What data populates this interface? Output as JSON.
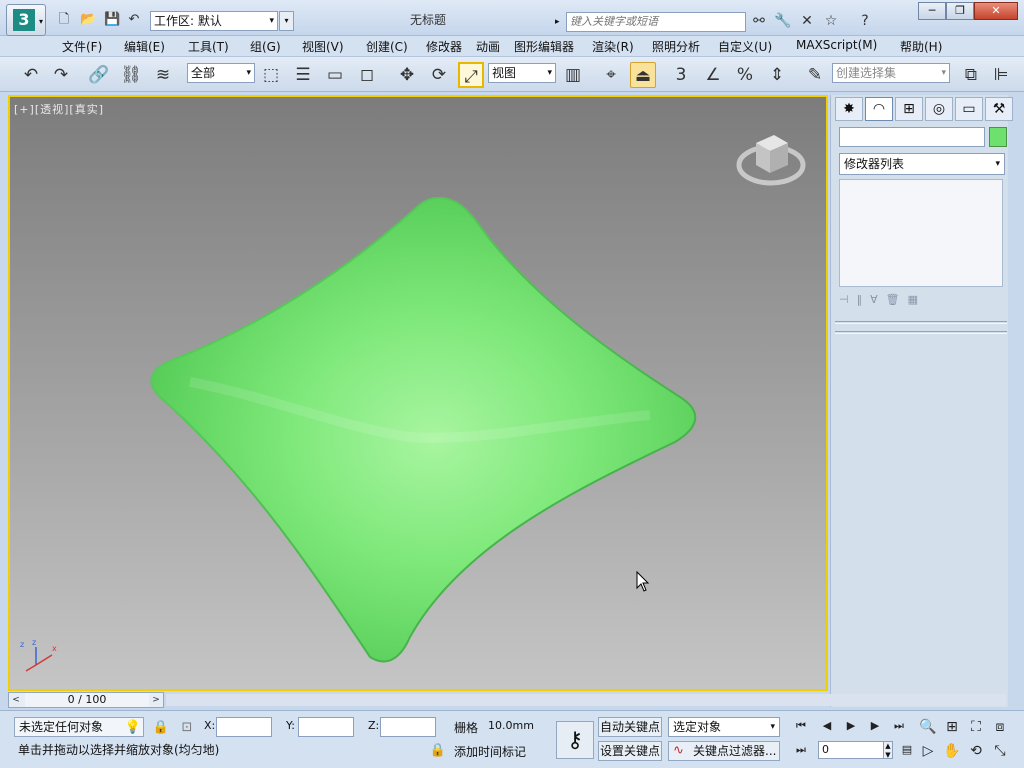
{
  "title_bar": {
    "app_logo": "3",
    "workspace_label": "工作区: 默认",
    "document_title": "无标题",
    "search_placeholder": "键入关键字或短语",
    "quick_access_icons": [
      "new-file-icon",
      "open-folder-icon",
      "save-icon",
      "undo-arrow-icon",
      "redo-arrow-icon"
    ],
    "info_icons": [
      "binoculars-icon",
      "wrench-icon",
      "exchange-icon",
      "star-icon",
      "help-icon"
    ]
  },
  "menu": {
    "items": [
      "文件(F)",
      "编辑(E)",
      "工具(T)",
      "组(G)",
      "视图(V)",
      "创建(C)",
      "修改器",
      "动画",
      "图形编辑器",
      "渲染(R)",
      "照明分析",
      "自定义(U)",
      "MAXScript(M)",
      "帮助(H)"
    ]
  },
  "toolbar": {
    "selection_filter": "全部",
    "reference_coord": "视图",
    "named_selection_placeholder": "创建选择集",
    "snap_label": "3",
    "angle_snap_label": "",
    "percent_snap_label": "%"
  },
  "viewport": {
    "label_plus": "[+]",
    "label_view": "[透视]",
    "label_shading": "[真实]",
    "object_color": "#6fe06f",
    "background_top": "#7c7c7c",
    "background_bottom": "#c5c5c5",
    "active_border_color": "#f0d000"
  },
  "command_panel": {
    "tabs": [
      "create-icon",
      "modify-icon",
      "hierarchy-icon",
      "motion-icon",
      "display-icon",
      "utilities-icon"
    ],
    "active_tab": "modify-icon",
    "modifier_list": "修改器列表",
    "swatch_color": "#6ee06e"
  },
  "time_slider": {
    "frame_display": "0 / 100"
  },
  "status": {
    "selection_info": "未选定任何对象",
    "prompt": "单击并拖动以选择并缩放对象(均匀地)",
    "x_label": "X:",
    "y_label": "Y:",
    "z_label": "Z:",
    "grid_label": "栅格",
    "grid_value": "10.0mm",
    "add_time_tag": "添加时间标记",
    "auto_key": "自动关键点",
    "set_key": "设置关键点",
    "selection_set": "选定对象",
    "key_filters": "关键点过滤器...",
    "current_frame": "0"
  }
}
